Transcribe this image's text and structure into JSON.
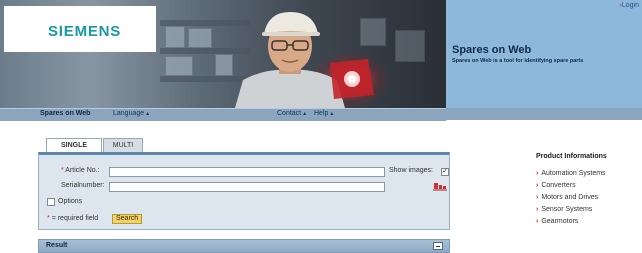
{
  "header": {
    "logo": "SIEMENS",
    "login_label": "Login",
    "site_title": "Spares on Web",
    "site_subtitle": "Spares on Web is a tool for identifying spare parts"
  },
  "nav": {
    "items": [
      {
        "label": "Spares on Web",
        "active": true
      },
      {
        "label": "Language",
        "dropdown": true
      },
      {
        "label": "Contact",
        "dropdown": true
      },
      {
        "label": "Help",
        "dropdown": true
      }
    ]
  },
  "tabs": [
    {
      "label": "SINGLE",
      "active": true
    },
    {
      "label": "MULTI",
      "active": false
    }
  ],
  "form": {
    "article_no_label": "Article No.:",
    "article_no_value": "",
    "serial_number_label": "Serialnumber:",
    "serial_number_value": "",
    "show_images_label": "Show images:",
    "show_images_checked": true,
    "options_label": "Options",
    "options_checked": false,
    "required_note": "= required field",
    "required_marker": "*",
    "search_button": "Search",
    "reset_icon": "eraser-icon"
  },
  "result": {
    "title": "Result",
    "collapse_icon": "minimize-icon"
  },
  "product_info": {
    "heading": "Product Informations",
    "items": [
      "Automation Systems",
      "Converters",
      "Motors and Drives",
      "Sensor Systems",
      "Gearmotors"
    ]
  },
  "colors": {
    "brand_teal": "#169aa6",
    "header_blue": "#8eb8da",
    "nav_blue": "#8aa5bd",
    "form_bg": "#dde6ee",
    "button_yellow": "#f1d36a",
    "link_arrow_red": "#d01f1f"
  }
}
